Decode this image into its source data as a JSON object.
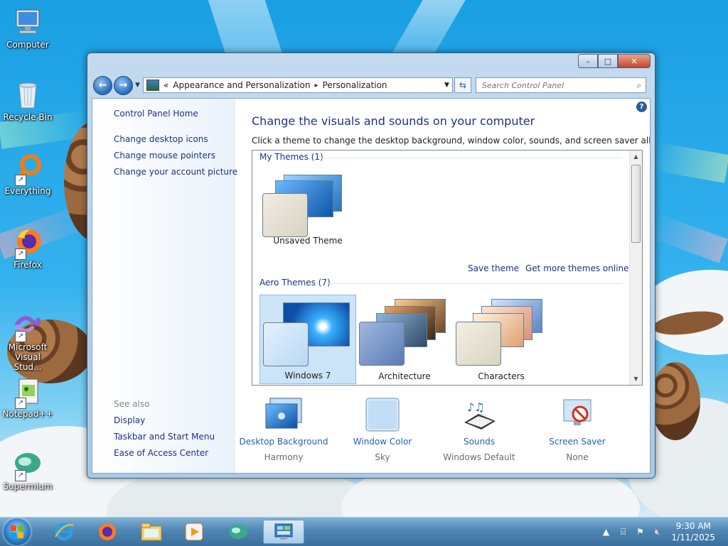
{
  "desktop": {
    "icons": [
      {
        "label": "Computer"
      },
      {
        "label": "Recycle Bin"
      },
      {
        "label": "Everything"
      },
      {
        "label": "Firefox"
      },
      {
        "label": "Microsoft Visual Stud..."
      },
      {
        "label": "Notepad++"
      },
      {
        "label": "Supermium"
      }
    ]
  },
  "window": {
    "caption": {
      "minimize": "–",
      "maximize": "□",
      "close": "✕"
    },
    "address": {
      "overflow": "«",
      "crumbs": [
        "Appearance and Personalization",
        "Personalization"
      ],
      "separator": "▸"
    },
    "search": {
      "placeholder": "Search Control Panel"
    },
    "left_pane": {
      "home": "Control Panel Home",
      "links": [
        "Change desktop icons",
        "Change mouse pointers",
        "Change your account picture"
      ],
      "see_also_title": "See also",
      "see_also": [
        "Display",
        "Taskbar and Start Menu",
        "Ease of Access Center"
      ]
    },
    "heading": "Change the visuals and sounds on your computer",
    "subheading": "Click a theme to change the desktop background, window color, sounds, and screen saver all at once.",
    "my_themes": {
      "title": "My Themes (1)",
      "items": [
        {
          "label": "Unsaved Theme"
        }
      ],
      "save_link": "Save theme",
      "online_link": "Get more themes online"
    },
    "aero_themes": {
      "title": "Aero Themes (7)",
      "items": [
        {
          "label": "Windows 7",
          "selected": true
        },
        {
          "label": "Architecture",
          "selected": false
        },
        {
          "label": "Characters",
          "selected": false
        }
      ]
    },
    "settings": [
      {
        "link": "Desktop Background",
        "value": "Harmony",
        "icon": "desktop-background-icon"
      },
      {
        "link": "Window Color",
        "value": "Sky",
        "icon": "window-color-icon"
      },
      {
        "link": "Sounds",
        "value": "Windows Default",
        "icon": "sounds-icon"
      },
      {
        "link": "Screen Saver",
        "value": "None",
        "icon": "screen-saver-icon"
      }
    ]
  },
  "taskbar": {
    "items": [
      "internet-explorer-icon",
      "firefox-icon",
      "file-explorer-icon",
      "media-player-icon",
      "supermium-icon",
      "control-panel-icon"
    ],
    "clock": {
      "time": "9:30 AM",
      "date": "1/11/2025"
    }
  },
  "colors": {
    "link": "#1e3287",
    "setting_link": "#1e64b4",
    "selection": "#cce4f7"
  }
}
